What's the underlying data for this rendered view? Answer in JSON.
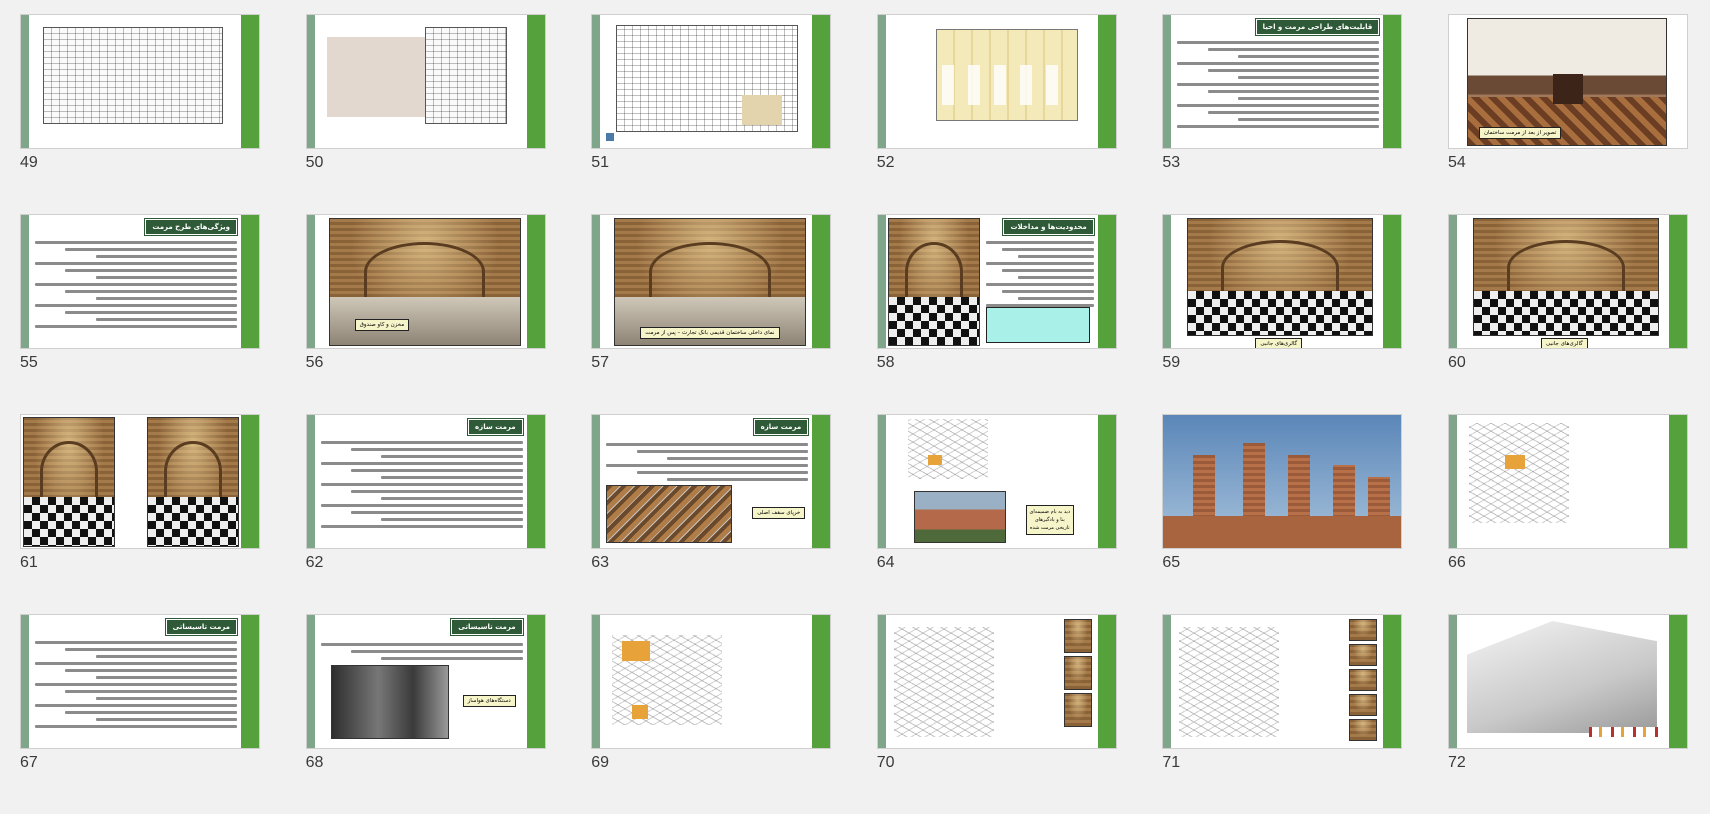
{
  "slides": [
    {
      "number": "49",
      "kind": "plan"
    },
    {
      "number": "50",
      "kind": "plan-shaded"
    },
    {
      "number": "51",
      "kind": "section"
    },
    {
      "number": "52",
      "kind": "elevation"
    },
    {
      "number": "53",
      "kind": "text",
      "title": "قابلیت‌های طراحی مرمت و احیا"
    },
    {
      "number": "54",
      "kind": "photo-interior",
      "caption": "تصویر از بعد از مرمت ساختمان"
    },
    {
      "number": "55",
      "kind": "text",
      "title": "ویژگی‌های طرح مرمت"
    },
    {
      "number": "56",
      "kind": "photo-arch",
      "caption": "مخزن و کاو صندوق"
    },
    {
      "number": "57",
      "kind": "photo-arch",
      "caption": "نمای داخلی ساختمان قدیمی بانک تجارت – پس از مرمت"
    },
    {
      "number": "58",
      "kind": "text-photo",
      "title": "محدودیت‌ها و مداخلات"
    },
    {
      "number": "59",
      "kind": "photo-arch",
      "caption": "گالری‌های جانبی"
    },
    {
      "number": "60",
      "kind": "photo-arch",
      "caption": "گالری‌های جانبی"
    },
    {
      "number": "61",
      "kind": "two-photos"
    },
    {
      "number": "62",
      "kind": "text",
      "title": "مرمت سازه"
    },
    {
      "number": "63",
      "kind": "text-photo",
      "title": "مرمت سازه",
      "caption": "خرپای سقف اصلی"
    },
    {
      "number": "64",
      "kind": "axo-photo",
      "caption": "دید به بام ضمیمه‌ای بنا و بادگیرهای تاریخی مرمت شده"
    },
    {
      "number": "65",
      "kind": "photo-windtowers"
    },
    {
      "number": "66",
      "kind": "axo"
    },
    {
      "number": "67",
      "kind": "text",
      "title": "مرمت تاسیساتی"
    },
    {
      "number": "68",
      "kind": "text-photo",
      "title": "مرمت تاسیساتی",
      "caption": "دستگاه‌های هواساز"
    },
    {
      "number": "69",
      "kind": "axo-orange"
    },
    {
      "number": "70",
      "kind": "axo-photos"
    },
    {
      "number": "71",
      "kind": "axo-photos"
    },
    {
      "number": "72",
      "kind": "render"
    }
  ]
}
